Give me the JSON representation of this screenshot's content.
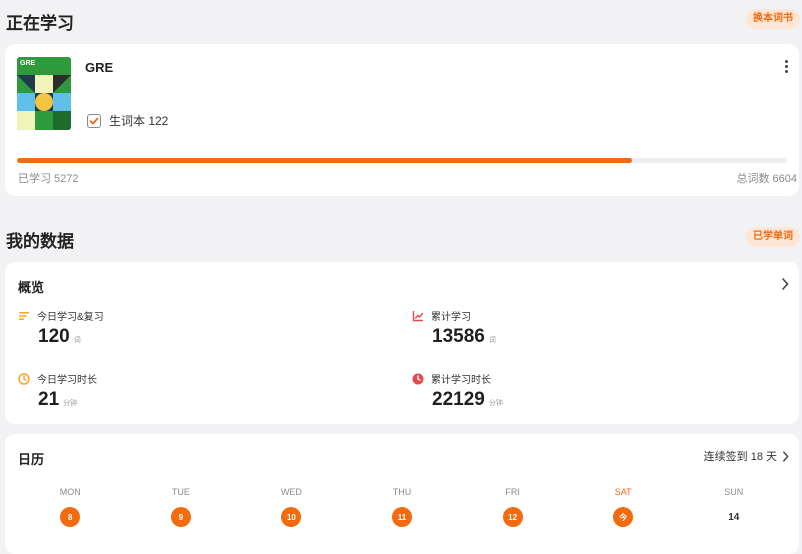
{
  "learning": {
    "title": "正在学习",
    "change_book_label": "换本词书"
  },
  "book": {
    "cover_label": "GRE",
    "name": "GRE",
    "wordbook_label": "生词本 122",
    "wordbook_checked": true,
    "learned_label": "已学习 5272",
    "total_label": "总词数 6604",
    "progress_fraction": 0.7983
  },
  "my_data": {
    "title": "我的数据",
    "learned_words_label": "已学单词"
  },
  "overview": {
    "title": "概览",
    "stats": [
      {
        "label": "今日学习&复习",
        "value": "120",
        "unit": "词",
        "icon": "list-lines-icon",
        "color": "#f5a623"
      },
      {
        "label": "累计学习",
        "value": "13586",
        "unit": "词",
        "icon": "trend-chart-icon",
        "color": "#e5484d"
      },
      {
        "label": "今日学习时长",
        "value": "21",
        "unit": "分钟",
        "icon": "clock-icon",
        "color": "#f5a623"
      },
      {
        "label": "累计学习时长",
        "value": "22129",
        "unit": "分钟",
        "icon": "clock-filled-icon",
        "color": "#e5484d"
      }
    ]
  },
  "calendar": {
    "title": "日历",
    "streak_label": "连续签到 18 天",
    "weekdays": [
      "MON",
      "TUE",
      "WED",
      "THU",
      "FRI",
      "SAT",
      "SUN"
    ],
    "dates": [
      "8",
      "9",
      "10",
      "11",
      "12",
      "今",
      "14"
    ],
    "checked_in": [
      true,
      true,
      true,
      true,
      true,
      true,
      false
    ],
    "today_index": 5
  },
  "colors": {
    "accent": "#f26b0f",
    "accent_light": "#fde6d6",
    "background": "#f2f2f4",
    "card": "#ffffff"
  }
}
